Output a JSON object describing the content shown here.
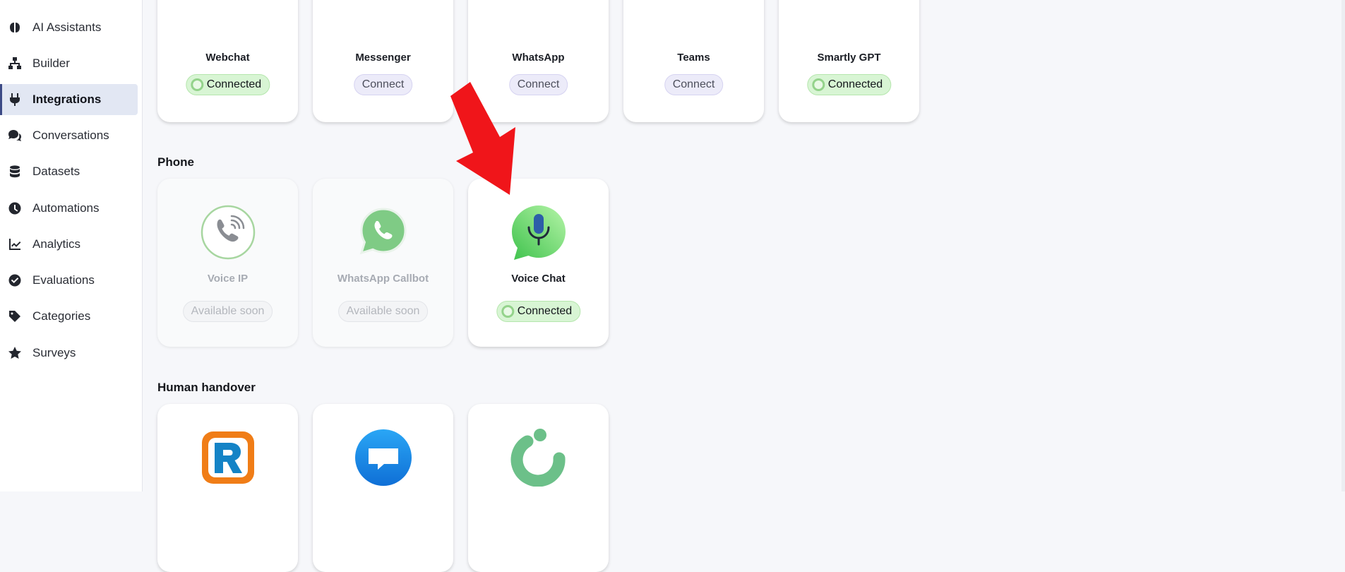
{
  "sidebar": {
    "items": [
      {
        "label": "AI Assistants",
        "icon": "brain-icon",
        "active": false
      },
      {
        "label": "Builder",
        "icon": "sitemap-icon",
        "active": false
      },
      {
        "label": "Integrations",
        "icon": "plug-icon",
        "active": true
      },
      {
        "label": "Conversations",
        "icon": "comments-icon",
        "active": false
      },
      {
        "label": "Datasets",
        "icon": "database-icon",
        "active": false
      },
      {
        "label": "Automations",
        "icon": "clock-icon",
        "active": false
      },
      {
        "label": "Analytics",
        "icon": "chart-line-icon",
        "active": false
      },
      {
        "label": "Evaluations",
        "icon": "check-circle-icon",
        "active": false
      },
      {
        "label": "Categories",
        "icon": "tag-icon",
        "active": false
      },
      {
        "label": "Surveys",
        "icon": "star-icon",
        "active": false
      }
    ]
  },
  "channels": {
    "cards": [
      {
        "name": "Webchat",
        "status": "Connected",
        "icon": "webchat-icon"
      },
      {
        "name": "Messenger",
        "status": "Connect",
        "icon": "messenger-icon"
      },
      {
        "name": "WhatsApp",
        "status": "Connect",
        "icon": "whatsapp-icon"
      },
      {
        "name": "Teams",
        "status": "Connect",
        "icon": "teams-icon"
      },
      {
        "name": "Smartly GPT",
        "status": "Connected",
        "icon": "smartly-gpt-icon"
      }
    ]
  },
  "phone": {
    "title": "Phone",
    "cards": [
      {
        "name": "Voice IP",
        "status": "Available soon",
        "icon": "phone-icon"
      },
      {
        "name": "WhatsApp Callbot",
        "status": "Available soon",
        "icon": "whatsapp-callbot-icon"
      },
      {
        "name": "Voice Chat",
        "status": "Connected",
        "icon": "voice-chat-icon"
      }
    ]
  },
  "human_handover": {
    "title": "Human handover",
    "cards": [
      {
        "icon": "r-logo-icon"
      },
      {
        "icon": "chat-bubble-icon"
      },
      {
        "icon": "ring-logo-icon"
      }
    ]
  },
  "colors": {
    "accent": "#3c4a86",
    "connected_bg": "#d8f5d4",
    "connect_bg": "#ecebf9",
    "arrow": "#f0151a"
  }
}
